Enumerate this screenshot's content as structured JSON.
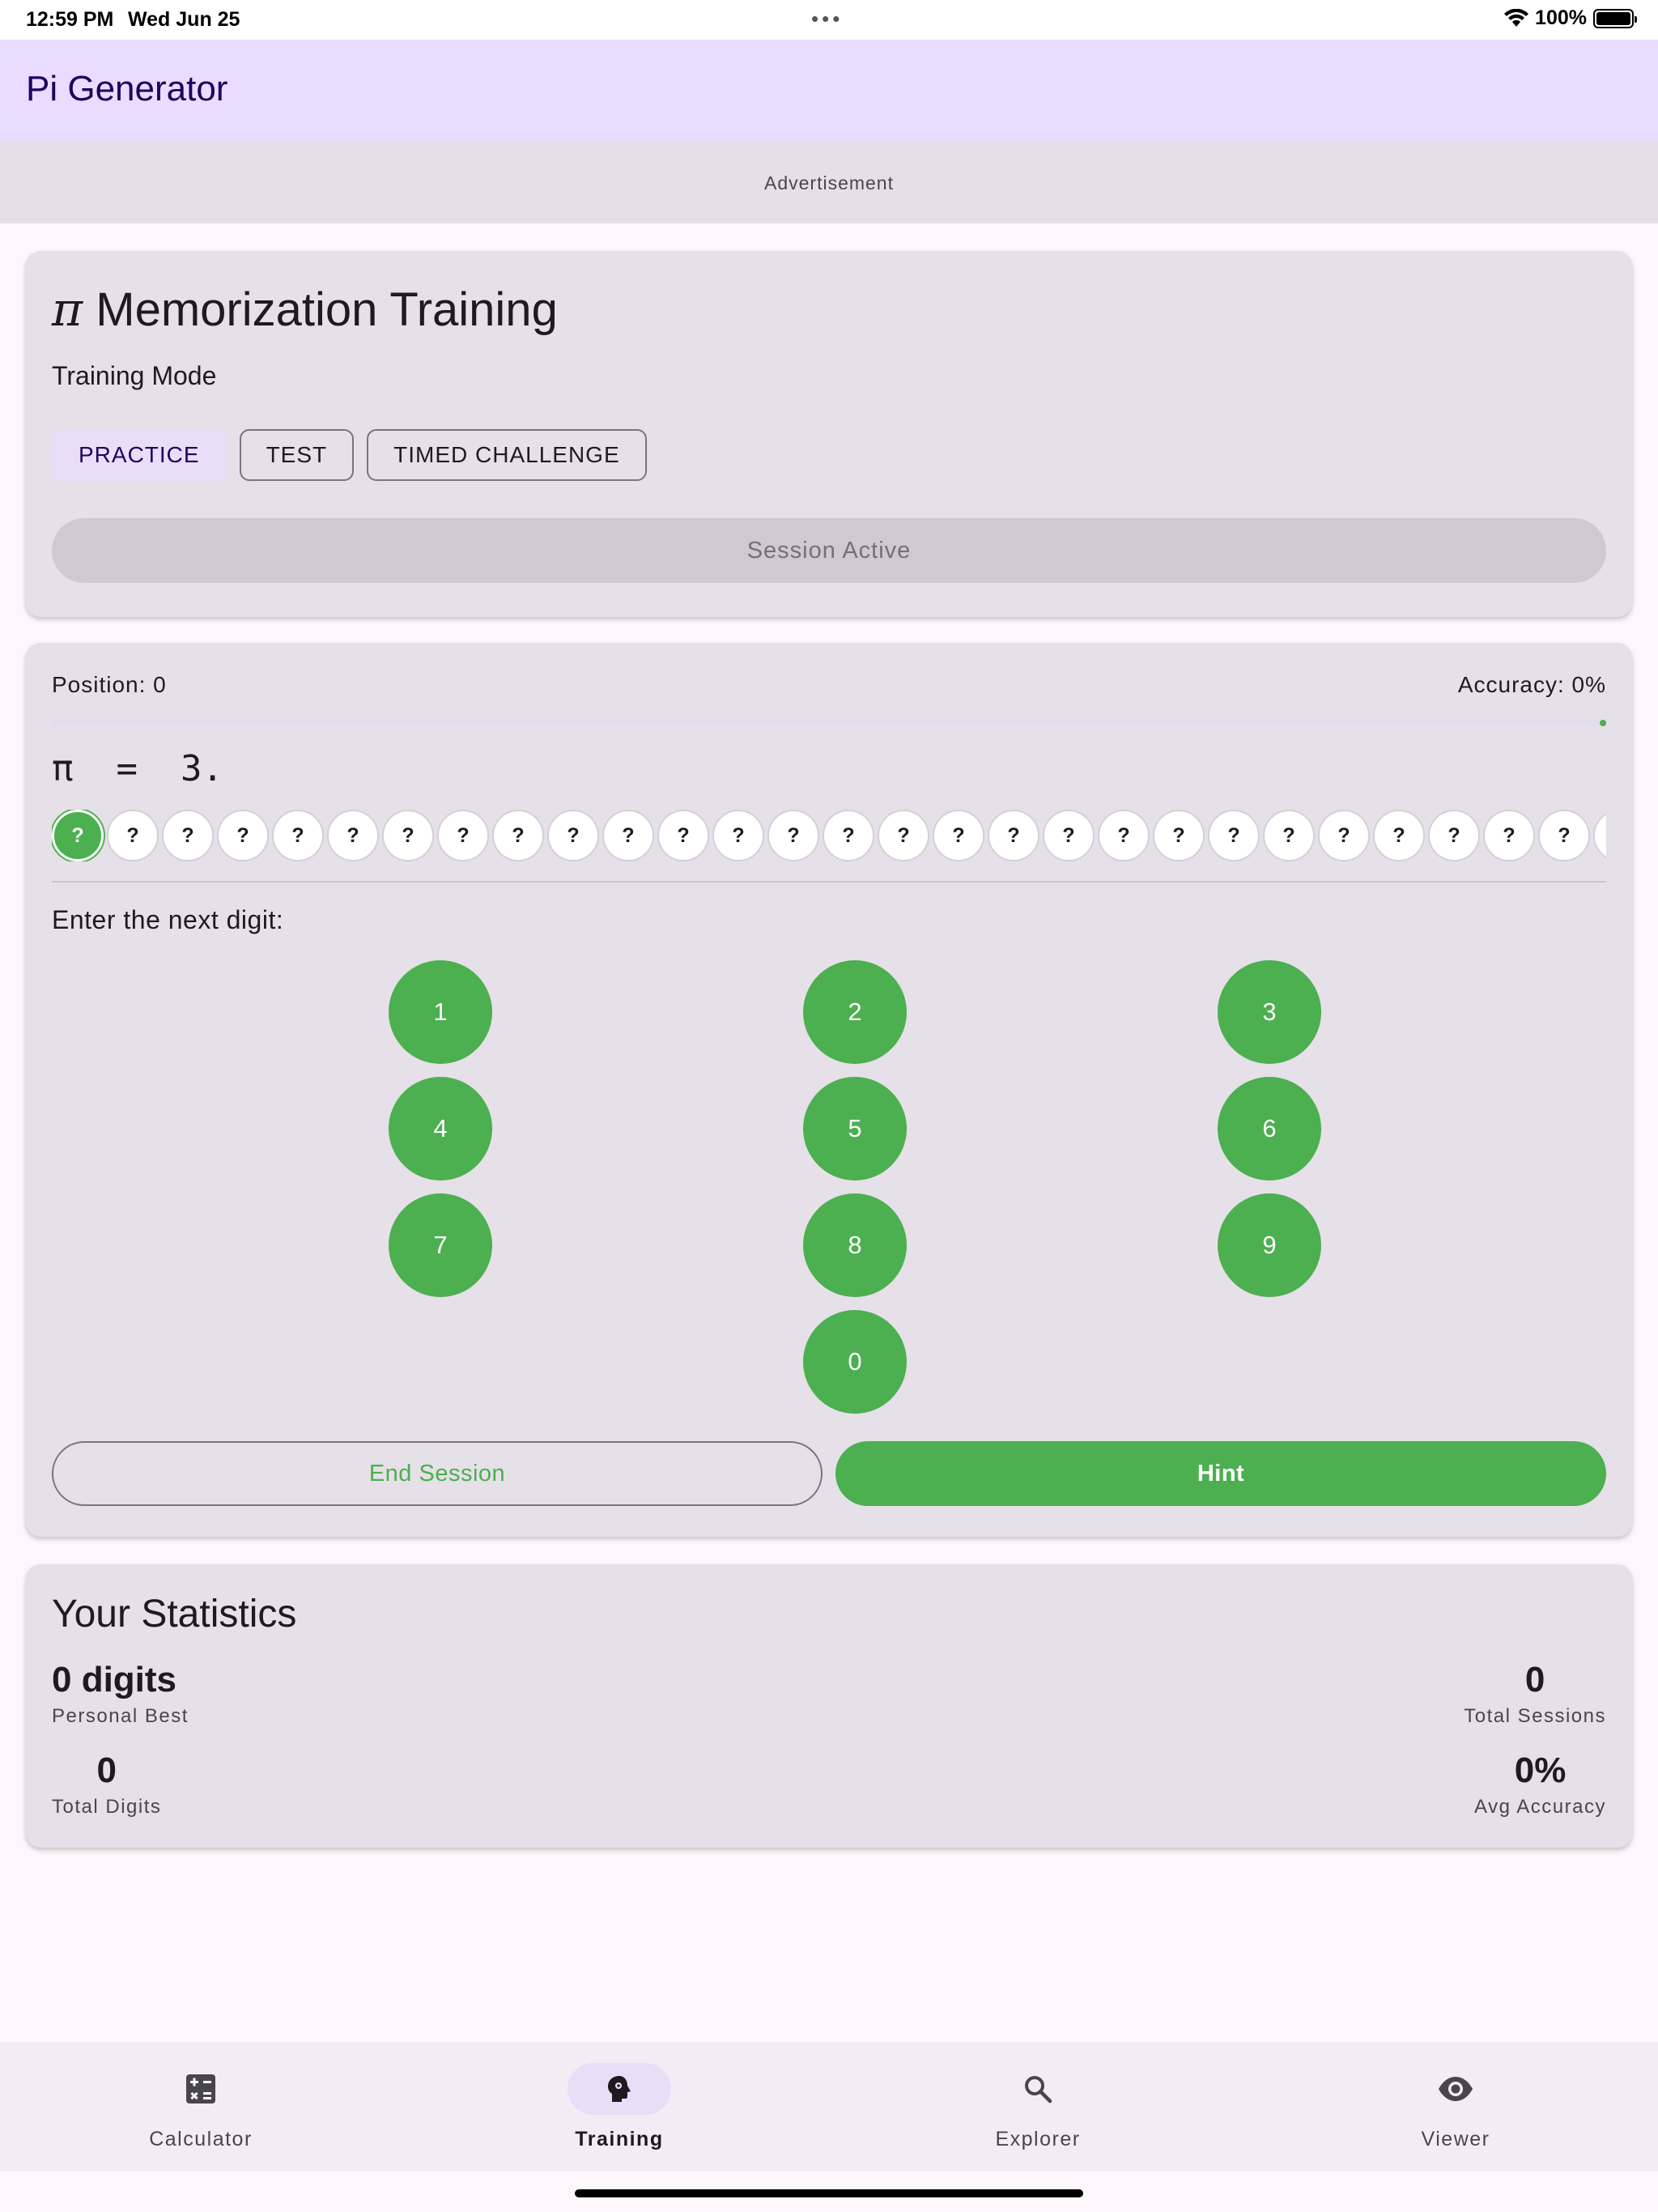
{
  "status_bar": {
    "time": "12:59 PM",
    "date": "Wed Jun 25",
    "dots": "•••",
    "battery": "100%"
  },
  "app": {
    "title": "Pi Generator"
  },
  "ad": {
    "label": "Advertisement"
  },
  "training": {
    "symbol": "π",
    "title": "Memorization Training",
    "mode_label": "Training Mode",
    "modes": [
      {
        "label": "PRACTICE",
        "selected": true
      },
      {
        "label": "TEST",
        "selected": false
      },
      {
        "label": "TIMED CHALLENGE",
        "selected": false
      }
    ],
    "session_button": "Session Active"
  },
  "session": {
    "position": "Position: 0",
    "accuracy": "Accuracy: 0%",
    "progress": 0,
    "pi_prefix": "π  =  3.",
    "hidden_digit": "?",
    "visible_digit_count": 29,
    "current_index": 0,
    "prompt": "Enter the next digit:",
    "keys": [
      "1",
      "2",
      "3",
      "4",
      "5",
      "6",
      "7",
      "8",
      "9",
      "0"
    ],
    "end_label": "End Session",
    "hint_label": "Hint"
  },
  "statistics": {
    "title": "Your Statistics",
    "personal_best_value": "0 digits",
    "personal_best_label": "Personal Best",
    "total_sessions_value": "0",
    "total_sessions_label": "Total Sessions",
    "total_digits_value": "0",
    "total_digits_label": "Total Digits",
    "avg_accuracy_value": "0%",
    "avg_accuracy_label": "Avg Accuracy"
  },
  "nav": {
    "items": [
      {
        "label": "Calculator",
        "icon": "calculator-icon",
        "active": false
      },
      {
        "label": "Training",
        "icon": "brain-icon",
        "active": true
      },
      {
        "label": "Explorer",
        "icon": "search-icon",
        "active": false
      },
      {
        "label": "Viewer",
        "icon": "eye-icon",
        "active": false
      }
    ]
  },
  "colors": {
    "accent": "#4caf50",
    "app_bar": "#eadcfe",
    "card": "#e6e0e8"
  }
}
